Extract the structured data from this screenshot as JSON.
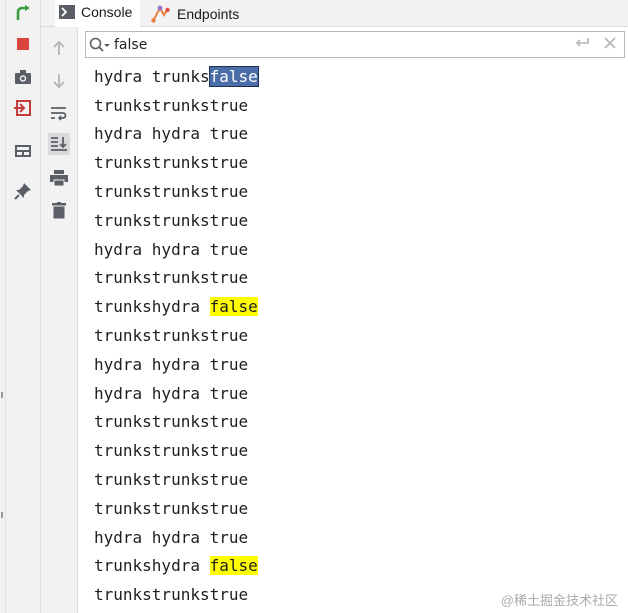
{
  "tabs": [
    {
      "label": "Console",
      "icon": "console-icon"
    },
    {
      "label": "Endpoints",
      "icon": "endpoints-icon"
    }
  ],
  "run_toolbar": [
    "rerun-icon",
    "stop-icon",
    "camera-icon",
    "exit-icon",
    "layout-icon",
    "pin-icon"
  ],
  "side_toolbar": [
    "arrow-up-icon",
    "arrow-down-icon",
    "soft-wrap-icon",
    "scroll-to-end-icon",
    "print-icon",
    "trash-icon"
  ],
  "search": {
    "value": "false",
    "placeholder": ""
  },
  "console": {
    "lines": [
      {
        "a": "hydra ",
        "b": "trunks",
        "c": "false",
        "match": "current"
      },
      {
        "a": "trunks",
        "b": "trunks",
        "c": "true",
        "match": "none"
      },
      {
        "a": "hydra ",
        "b": "hydra ",
        "c": "true",
        "match": "none"
      },
      {
        "a": "trunks",
        "b": "trunks",
        "c": "true",
        "match": "none"
      },
      {
        "a": "trunks",
        "b": "trunks",
        "c": "true",
        "match": "none"
      },
      {
        "a": "trunks",
        "b": "trunks",
        "c": "true",
        "match": "none"
      },
      {
        "a": "hydra ",
        "b": "hydra ",
        "c": "true",
        "match": "none"
      },
      {
        "a": "trunks",
        "b": "trunks",
        "c": "true",
        "match": "none"
      },
      {
        "a": "trunks",
        "b": "hydra ",
        "c": "false",
        "match": "highlight"
      },
      {
        "a": "trunks",
        "b": "trunks",
        "c": "true",
        "match": "none"
      },
      {
        "a": "hydra ",
        "b": "hydra ",
        "c": "true",
        "match": "none"
      },
      {
        "a": "hydra ",
        "b": "hydra ",
        "c": "true",
        "match": "none"
      },
      {
        "a": "trunks",
        "b": "trunks",
        "c": "true",
        "match": "none"
      },
      {
        "a": "trunks",
        "b": "trunks",
        "c": "true",
        "match": "none"
      },
      {
        "a": "trunks",
        "b": "trunks",
        "c": "true",
        "match": "none"
      },
      {
        "a": "trunks",
        "b": "trunks",
        "c": "true",
        "match": "none"
      },
      {
        "a": "hydra ",
        "b": "hydra ",
        "c": "true",
        "match": "none"
      },
      {
        "a": "trunks",
        "b": "hydra ",
        "c": "false",
        "match": "highlight"
      },
      {
        "a": "trunks",
        "b": "trunks",
        "c": "true",
        "match": "none"
      }
    ]
  },
  "watermark": "@稀土掘金技术社区",
  "colors": {
    "current_match": "#4b6ea9",
    "match": "#ffff00",
    "rerun": "#3c9b3c",
    "stop": "#d9453d"
  }
}
